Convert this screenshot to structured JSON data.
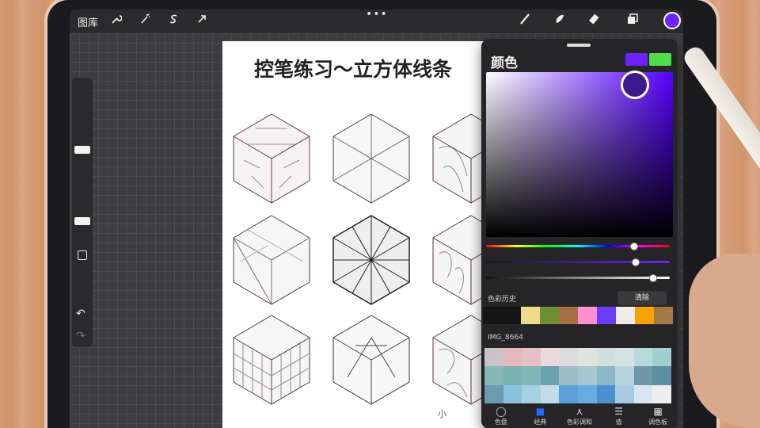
{
  "toolbar": {
    "gallery_label": "图库",
    "left_icons": [
      "wrench-icon",
      "magic-wand-icon",
      "selection-s-icon",
      "arrow-transform-icon"
    ],
    "right_icons": [
      "brush-icon",
      "smudge-icon",
      "eraser-icon",
      "layers-icon"
    ],
    "current_color": "#6b22ff"
  },
  "paper": {
    "title": "控笔练习～立方体线条",
    "watermark": "小"
  },
  "color_panel": {
    "title": "颜色",
    "current_swatch": "#6a22ff",
    "previous_swatch": "#4ede4a",
    "history_label": "色彩历史",
    "clear_label": "清除",
    "history_colors": [
      "#151515",
      "#151515",
      "#f1d98a",
      "#6c8f34",
      "#a66f45",
      "#ff8fd1",
      "#6a3cff",
      "#f1ede6",
      "#f7a400",
      "#a37a43"
    ],
    "palette_name": "IMG_8664",
    "palette_colors": [
      "#c8c3c6",
      "#e6b8bd",
      "#e8bfc2",
      "#eadada",
      "#dcdcdc",
      "#dfe3df",
      "#cfe0df",
      "#d6e3e4",
      "#b7dbdb",
      "#9fcfcf",
      "#88b7b5",
      "#7ab2b2",
      "#80b6b8",
      "#6aa3ad",
      "#9dbec4",
      "#a6c7d2",
      "#8bb8c6",
      "#b8d2dc",
      "#6f98a6",
      "#5d8fa0",
      "#6a9bb3",
      "#8ac0dc",
      "#a7d0e3",
      "#c3dcea",
      "#5aa0d8",
      "#68abde",
      "#4a8fce",
      "#a8c9e6",
      "#d9e6f2",
      "#eeeeee"
    ],
    "tabs": [
      {
        "label": "色盘",
        "icon": "disc-icon"
      },
      {
        "label": "经典",
        "icon": "classic-square-icon"
      },
      {
        "label": "色彩调和",
        "icon": "harmony-icon"
      },
      {
        "label": "值",
        "icon": "value-sliders-icon"
      },
      {
        "label": "调色板",
        "icon": "palettes-grid-icon"
      }
    ],
    "active_tab": "经典"
  }
}
